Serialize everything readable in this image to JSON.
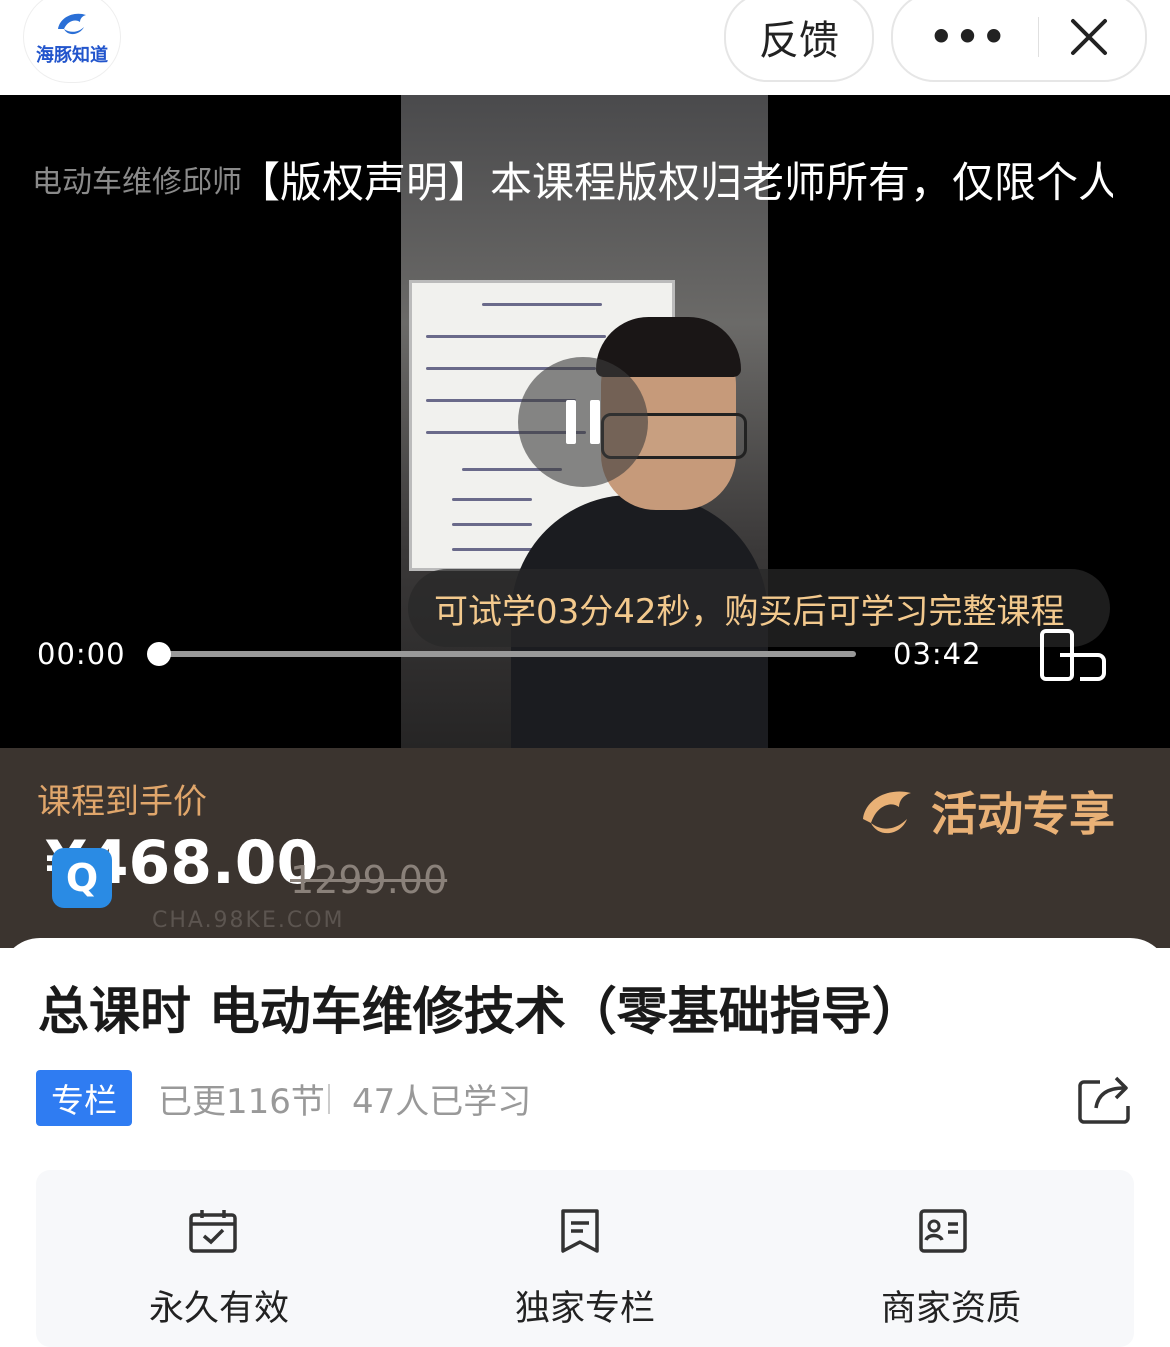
{
  "header": {
    "logo_text": "海豚知道",
    "feedback_label": "反馈",
    "more_label": "•••",
    "close_label": "✕"
  },
  "video": {
    "watermark_title": "电动车维修邱师",
    "copyright_notice": "【版权声明】本课程版权归老师所有，仅限个人学",
    "trial_notice": "可试学03分42秒，购买后可学习完整课程",
    "current_time": "00:00",
    "total_time": "03:42",
    "progress": 0
  },
  "promo": {
    "label": "课程到手价",
    "price": "¥468.00",
    "original_price": "1299.00",
    "event_label": "活动专享",
    "watermark": "CHA.98KE.COM"
  },
  "course": {
    "title": "总课时 电动车维修技术（零基础指导）",
    "tag": "专栏",
    "updated": "已更116节",
    "learners": "47人已学习"
  },
  "features": [
    {
      "label": "永久有效",
      "icon": "calendar-check-icon"
    },
    {
      "label": "独家专栏",
      "icon": "bookmark-icon"
    },
    {
      "label": "商家资质",
      "icon": "id-card-icon"
    }
  ],
  "colors": {
    "accent_blue": "#2f7cf2",
    "promo_bg": "#3b342f",
    "promo_gold": "#e9b176",
    "trial_text": "#f3c98d"
  }
}
